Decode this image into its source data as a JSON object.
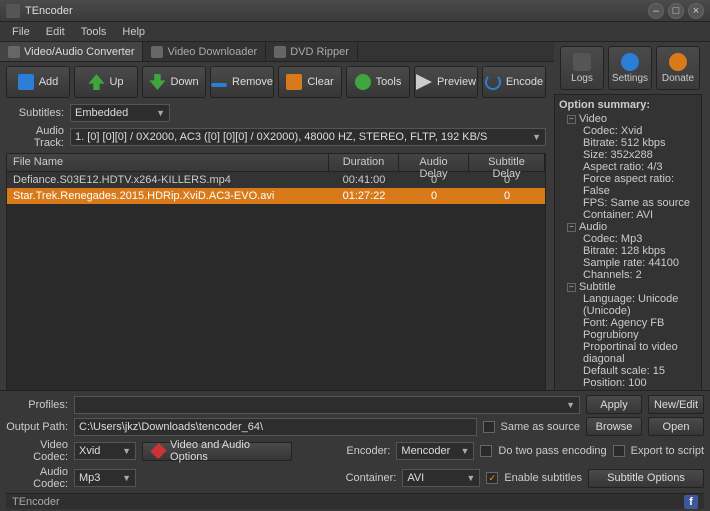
{
  "window": {
    "title": "TEncoder"
  },
  "menu": {
    "file": "File",
    "edit": "Edit",
    "tools": "Tools",
    "help": "Help"
  },
  "tabs": {
    "converter": "Video/Audio Converter",
    "downloader": "Video Downloader",
    "ripper": "DVD Ripper"
  },
  "rightButtons": {
    "logs": "Logs",
    "settings": "Settings",
    "donate": "Donate"
  },
  "toolbar": {
    "add": "Add",
    "up": "Up",
    "down": "Down",
    "remove": "Remove",
    "clear": "Clear",
    "tools": "Tools",
    "preview": "Preview",
    "encode": "Encode"
  },
  "options": {
    "subtitles_label": "Subtitles:",
    "subtitles_value": "Embedded",
    "audiotrack_label": "Audio Track:",
    "audiotrack_value": "1. [0] [0][0] / 0X2000, AC3 ([0] [0][0] / 0X2000), 48000 HZ, STEREO, FLTP, 192 KB/S"
  },
  "table": {
    "headers": {
      "name": "File Name",
      "duration": "Duration",
      "audio_delay": "Audio Delay",
      "subtitle_delay": "Subtitle Delay"
    },
    "rows": [
      {
        "name": "Defiance.S03E12.HDTV.x264-KILLERS.mp4",
        "duration": "00:41:00",
        "audio_delay": "0",
        "subtitle_delay": "0",
        "selected": false
      },
      {
        "name": "Star.Trek.Renegades.2015.HDRip.XviD.AC3-EVO.avi",
        "duration": "01:27:22",
        "audio_delay": "0",
        "subtitle_delay": "0",
        "selected": true
      }
    ]
  },
  "summary": {
    "title": "Option summary:",
    "video": {
      "label": "Video",
      "codec": "Codec: Xvid",
      "bitrate": "Bitrate: 512 kbps",
      "size": "Size: 352x288",
      "aspect": "Aspect ratio: 4/3",
      "force_aspect": "Force aspect ratio: False",
      "fps": "FPS: Same as source",
      "container": "Container: AVI"
    },
    "audio": {
      "label": "Audio",
      "codec": "Codec: Mp3",
      "bitrate": "Bitrate: 128 kbps",
      "sample": "Sample rate: 44100",
      "channels": "Channels: 2"
    },
    "subtitle": {
      "label": "Subtitle",
      "language": "Language: Unicode (Unicode)",
      "font": "Font: Agency FB Pogrubiony",
      "proportional": "Proportinal to video diagonal",
      "scale": "Default scale: 15",
      "position": "Position: 100"
    }
  },
  "bottom": {
    "profiles_label": "Profiles:",
    "profiles_value": "",
    "apply": "Apply",
    "newedit": "New/Edit",
    "outputpath_label": "Output Path:",
    "outputpath_value": "C:\\Users\\jkz\\Downloads\\tencoder_64\\",
    "same_as_source": "Same as source",
    "browse": "Browse",
    "open": "Open",
    "videocodec_label": "Video Codec:",
    "videocodec_value": "Xvid",
    "audiocodec_label": "Audio Codec:",
    "audiocodec_value": "Mp3",
    "va_options": "Video and Audio Options",
    "encoder_label": "Encoder:",
    "encoder_value": "Mencoder",
    "container_label": "Container:",
    "container_value": "AVI",
    "twopass": "Do two pass encoding",
    "export_script": "Export to script",
    "enable_subtitles": "Enable subtitles",
    "subtitle_options": "Subtitle Options"
  },
  "status": {
    "text": "TEncoder"
  }
}
